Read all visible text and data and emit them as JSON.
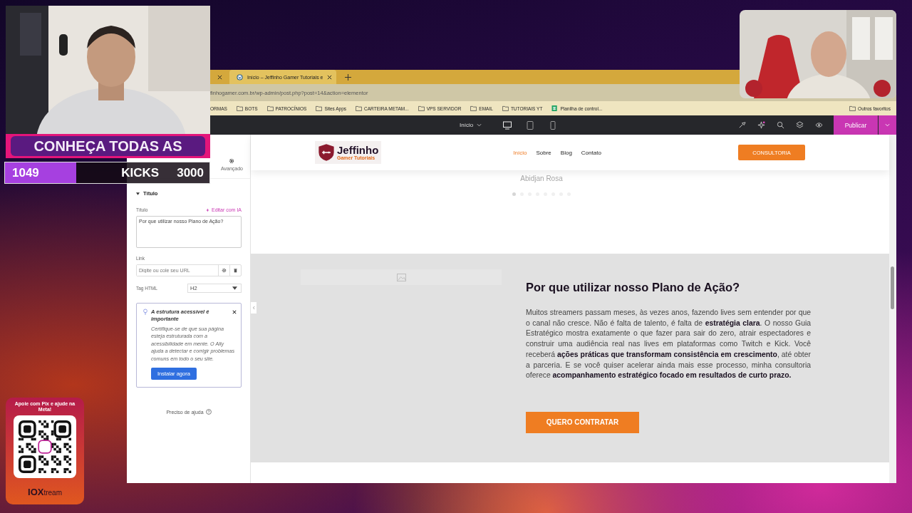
{
  "stream_overlay": {
    "banner": "CONHEÇA TODAS AS",
    "counter": {
      "current": "1049",
      "label": "KICKS",
      "goal": "3000",
      "level": 0.35
    },
    "pix_card": {
      "title": "Apoie com Pix e ajude na Meta!",
      "brand": "**IOX**tream"
    }
  },
  "browser": {
    "tabs": [
      {
        "selected": false
      },
      {
        "label": "Início – Jeffinho Gamer Tutoriais e",
        "selected": true
      }
    ],
    "url": "finhogamer.com.br/wp-admin/post.php?post=14&action=elementor",
    "bookmarks": [
      {
        "kind": "plain",
        "label": "ORMAS"
      },
      {
        "kind": "folder",
        "label": "BOTS"
      },
      {
        "kind": "folder",
        "label": "PATROCÍNIOS"
      },
      {
        "kind": "folder",
        "label": "Sites Apps"
      },
      {
        "kind": "folder",
        "label": "CARTEIRA METAM..."
      },
      {
        "kind": "folder",
        "label": "VPS SERVIDOR"
      },
      {
        "kind": "folder",
        "label": "EMAIL"
      },
      {
        "kind": "folder",
        "label": "TUTORIAIS YT"
      },
      {
        "kind": "sheet",
        "label": "Planilha de control..."
      }
    ],
    "other_bookmarks": "Outros favoritos"
  },
  "editor_bar": {
    "page_menu": "Início",
    "devices": [
      {
        "kind": "desktop",
        "selected": true
      },
      {
        "kind": "tablet",
        "selected": false
      },
      {
        "kind": "mobile",
        "selected": false
      }
    ],
    "publish": "Publicar"
  },
  "panel": {
    "tab": {
      "label": "Avançado",
      "selected": false
    },
    "section": "Título",
    "field_label": "Título",
    "ai_link": "Editar com IA",
    "title_value": "Por que utilizar nosso Plano de Ação?",
    "link_label": "Link",
    "link_placeholder": "Digite ou cole seu URL",
    "tag_label": "Tag HTML",
    "tag_value": "H2",
    "notice": {
      "title": "A estrutura acessível é importante",
      "body": "Certifique-se de que sua página esteja estruturada com a acessibilidade em mente. O Ally ajuda a detectar e corrigir problemas comuns em todo o seu site.",
      "button": "Instalar agora"
    },
    "help": "Preciso de ajuda"
  },
  "site": {
    "logo": {
      "line1": "Jeffinho",
      "line2": "Gamer Tutoriais"
    },
    "nav": [
      {
        "label": "Início",
        "selected": true
      },
      {
        "label": "Sobre",
        "selected": false
      },
      {
        "label": "Blog",
        "selected": false
      },
      {
        "label": "Contato",
        "selected": false
      }
    ],
    "cta": "CONSULTORIA",
    "testimonial_name": "Abidjan Rosa",
    "carousel_dots": [
      {
        "selected": true
      },
      {
        "selected": false
      },
      {
        "selected": false
      },
      {
        "selected": false
      },
      {
        "selected": false
      },
      {
        "selected": false
      },
      {
        "selected": false
      },
      {
        "selected": false
      }
    ],
    "heading": "Por que utilizar nosso Plano de Ação?",
    "paragraph": "Muitos streamers passam meses, às vezes anos, fazendo lives sem entender por que o canal não cresce. Não é falta de talento, é falta de **estratégia clara**. O nosso Guia Estratégico mostra exatamente o que fazer para sair do zero, atrair espectadores e construir uma audiência real nas lives em plataformas como Twitch e Kick. Você receberá **ações práticas que transformam consistência em crescimento**, até obter a parceria. E se você quiser acelerar ainda mais esse processo, minha consultoria oferece **acompanhamento estratégico focado em resultados de curto prazo.**",
    "button": "QUERO CONTRATAR"
  }
}
